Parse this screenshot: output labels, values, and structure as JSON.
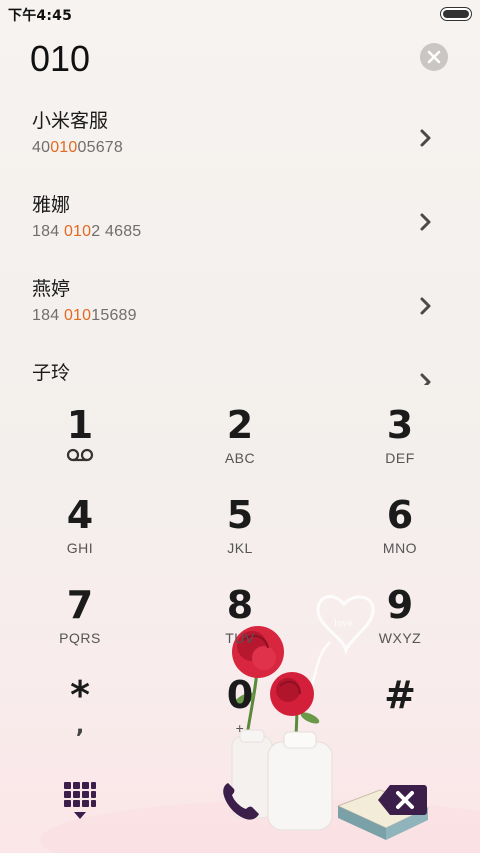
{
  "status_bar": {
    "time": "下午4:45"
  },
  "search": {
    "query": "010",
    "clear_icon": "close-icon"
  },
  "results": [
    {
      "name": "小米客服",
      "number_parts": [
        {
          "text": "40",
          "hl": false
        },
        {
          "text": "010",
          "hl": true
        },
        {
          "text": "05678",
          "hl": false
        }
      ]
    },
    {
      "name": "雅娜",
      "number_parts": [
        {
          "text": "184 ",
          "hl": false
        },
        {
          "text": "010",
          "hl": true
        },
        {
          "text": "2 4685",
          "hl": false
        }
      ]
    },
    {
      "name": "燕婷",
      "number_parts": [
        {
          "text": "184 ",
          "hl": false
        },
        {
          "text": "010",
          "hl": true
        },
        {
          "text": "15689",
          "hl": false
        }
      ]
    },
    {
      "name": "子玲",
      "number_parts": []
    }
  ],
  "keypad": {
    "keys": [
      {
        "digit": "1",
        "letters": "",
        "sub": "voicemail"
      },
      {
        "digit": "2",
        "letters": "ABC"
      },
      {
        "digit": "3",
        "letters": "DEF"
      },
      {
        "digit": "4",
        "letters": "GHI"
      },
      {
        "digit": "5",
        "letters": "JKL"
      },
      {
        "digit": "6",
        "letters": "MNO"
      },
      {
        "digit": "7",
        "letters": "PQRS"
      },
      {
        "digit": "8",
        "letters": "TUV"
      },
      {
        "digit": "9",
        "letters": "WXYZ"
      },
      {
        "digit": "*",
        "letters": ",",
        "sub": "comma"
      },
      {
        "digit": "0",
        "letters": "+"
      },
      {
        "digit": "#",
        "letters": ""
      }
    ]
  },
  "actions": {
    "dialpad_icon": "dialpad-grid-icon",
    "call_icon": "phone-icon",
    "delete_icon": "backspace-icon"
  },
  "colors": {
    "highlight": "#e46a23",
    "text": "#1a1a1a",
    "accent": "#3b1f4a"
  },
  "decoration": {
    "heart_text": "love"
  }
}
